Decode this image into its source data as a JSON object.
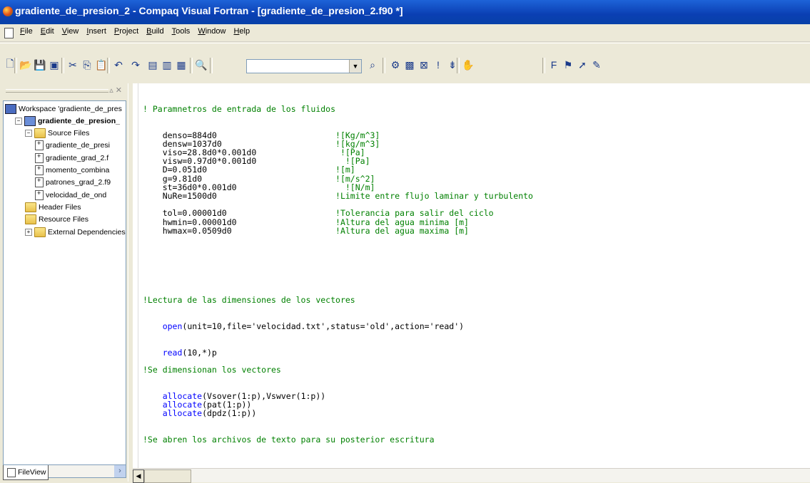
{
  "window": {
    "title": "gradiente_de_presion_2 - Compaq Visual Fortran - [gradiente_de_presion_2.f90 *]"
  },
  "menu": [
    "File",
    "Edit",
    "View",
    "Insert",
    "Project",
    "Build",
    "Tools",
    "Window",
    "Help"
  ],
  "toolbar": {
    "combo_value": "",
    "buttons": [
      "new-icon",
      "open-icon",
      "save-icon",
      "save-all-icon",
      "cut-icon",
      "copy-icon",
      "paste-icon",
      "undo-icon",
      "redo-icon",
      "workspace-icon",
      "output-icon",
      "window-list-icon",
      "find-in-files-icon",
      "find-icon",
      "compile-icon",
      "build-icon",
      "stop-build-icon",
      "execute-icon",
      "go-icon",
      "insert-breakpoint-icon",
      "f95-icon",
      "wizard-icon",
      "arrow-icon",
      "pen-icon"
    ]
  },
  "workspace": {
    "tab_label": "FileView",
    "tree": [
      {
        "label": "Workspace 'gradiente_de_pres",
        "level": 0,
        "icon": "workspace-icon"
      },
      {
        "label": "gradiente_de_presion_",
        "level": 1,
        "icon": "project-icon",
        "bold": true,
        "expander": "−"
      },
      {
        "label": "Source Files",
        "level": 2,
        "icon": "folder-icon",
        "expander": "−"
      },
      {
        "label": "gradiente_de_presi",
        "level": 3,
        "icon": "file-icon"
      },
      {
        "label": "gradiente_grad_2.f",
        "level": 3,
        "icon": "file-icon"
      },
      {
        "label": "momento_combina",
        "level": 3,
        "icon": "file-icon"
      },
      {
        "label": "patrones_grad_2.f9",
        "level": 3,
        "icon": "file-icon"
      },
      {
        "label": "velocidad_de_ond",
        "level": 3,
        "icon": "file-icon"
      },
      {
        "label": "Header Files",
        "level": 2,
        "icon": "folder-icon"
      },
      {
        "label": "Resource Files",
        "level": 2,
        "icon": "folder-icon"
      },
      {
        "label": "External Dependencies",
        "level": 2,
        "icon": "folder-icon",
        "expander": "+"
      }
    ]
  },
  "editor": {
    "lines": [
      {
        "row": 0,
        "parts": [
          {
            "t": "! Paramnetros de entrada de los fluidos",
            "c": "cmt"
          }
        ]
      },
      {
        "row": 2,
        "parts": []
      },
      {
        "row": 3,
        "parts": [
          {
            "t": "    denso=884d0                        ",
            "c": ""
          },
          {
            "t": "![Kg/m^3]",
            "c": "cmt"
          }
        ]
      },
      {
        "row": 4,
        "parts": [
          {
            "t": "    densw=1037d0                       ",
            "c": ""
          },
          {
            "t": "![kg/m^3]",
            "c": "cmt"
          }
        ]
      },
      {
        "row": 5,
        "parts": [
          {
            "t": "    viso=28.8d0*0.001d0                 ",
            "c": ""
          },
          {
            "t": "![Pa]",
            "c": "cmt"
          }
        ]
      },
      {
        "row": 6,
        "parts": [
          {
            "t": "    visw=0.97d0*0.001d0                  ",
            "c": ""
          },
          {
            "t": "![Pa]",
            "c": "cmt"
          }
        ]
      },
      {
        "row": 7,
        "parts": [
          {
            "t": "    D=0.051d0                          ",
            "c": ""
          },
          {
            "t": "![m]",
            "c": "cmt"
          }
        ]
      },
      {
        "row": 8,
        "parts": [
          {
            "t": "    g=9.81d0                           ",
            "c": ""
          },
          {
            "t": "![m/s^2]",
            "c": "cmt"
          }
        ]
      },
      {
        "row": 9,
        "parts": [
          {
            "t": "    st=36d0*0.001d0                      ",
            "c": ""
          },
          {
            "t": "![N/m]",
            "c": "cmt"
          }
        ]
      },
      {
        "row": 10,
        "parts": [
          {
            "t": "    NuRe=1500d0                        ",
            "c": ""
          },
          {
            "t": "!Limite entre flujo laminar y turbulento",
            "c": "cmt"
          }
        ]
      },
      {
        "row": 12,
        "parts": [
          {
            "t": "    tol=0.00001d0                      ",
            "c": ""
          },
          {
            "t": "!Tolerancia para salir del ciclo",
            "c": "cmt"
          }
        ]
      },
      {
        "row": 13,
        "parts": [
          {
            "t": "    hwmin=0.00001d0                    ",
            "c": ""
          },
          {
            "t": "!Altura del agua minima [m]",
            "c": "cmt"
          }
        ]
      },
      {
        "row": 14,
        "parts": [
          {
            "t": "    hwmax=0.0509d0                     ",
            "c": ""
          },
          {
            "t": "!Altura del agua maxima [m]",
            "c": "cmt"
          }
        ]
      },
      {
        "row": 22,
        "parts": [
          {
            "t": "!Lectura de las dimensiones de los vectores",
            "c": "cmt"
          }
        ]
      },
      {
        "row": 25,
        "parts": [
          {
            "t": "    open",
            "c": "kw"
          },
          {
            "t": "(unit=10,file='velocidad.txt',status='old',action='read')",
            "c": ""
          }
        ]
      },
      {
        "row": 28,
        "parts": [
          {
            "t": "    read",
            "c": "kw"
          },
          {
            "t": "(10,*)p",
            "c": ""
          }
        ]
      },
      {
        "row": 30,
        "parts": [
          {
            "t": "!Se dimensionan los vectores",
            "c": "cmt"
          }
        ]
      },
      {
        "row": 33,
        "parts": [
          {
            "t": "    allocate",
            "c": "kw"
          },
          {
            "t": "(Vsover(1:p),Vswver(1:p))",
            "c": ""
          }
        ]
      },
      {
        "row": 34,
        "parts": [
          {
            "t": "    allocate",
            "c": "kw"
          },
          {
            "t": "(pat(1:p))",
            "c": ""
          }
        ]
      },
      {
        "row": 35,
        "parts": [
          {
            "t": "    allocate",
            "c": "kw"
          },
          {
            "t": "(dpdz(1:p))",
            "c": ""
          }
        ]
      },
      {
        "row": 38,
        "parts": [
          {
            "t": "!Se abren los archivos de texto para su posterior escritura",
            "c": "cmt"
          }
        ]
      }
    ]
  }
}
